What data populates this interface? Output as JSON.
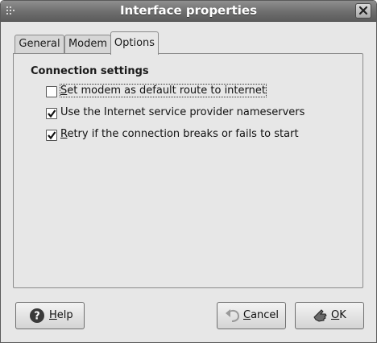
{
  "window": {
    "title": "Interface properties"
  },
  "tabs": [
    {
      "label": "General",
      "active": false
    },
    {
      "label": "Modem",
      "active": false
    },
    {
      "label": "Options",
      "active": true
    }
  ],
  "connection": {
    "section_title": "Connection settings",
    "options": [
      {
        "mnemonic": "S",
        "label_rest": "et modem as default route to internet",
        "checked": false
      },
      {
        "mnemonic": "",
        "label_rest": "Use the Internet service provider nameservers",
        "checked": true
      },
      {
        "mnemonic": "R",
        "label_rest": "etry if the connection breaks or fails to start",
        "checked": true
      }
    ]
  },
  "buttons": {
    "help": {
      "mnemonic": "H",
      "rest": "elp",
      "icon": "help-icon"
    },
    "cancel": {
      "mnemonic": "C",
      "rest": "ancel",
      "icon": "undo-arrow-icon"
    },
    "ok": {
      "mnemonic": "O",
      "rest": "K",
      "icon": "ok-hand-icon"
    }
  }
}
